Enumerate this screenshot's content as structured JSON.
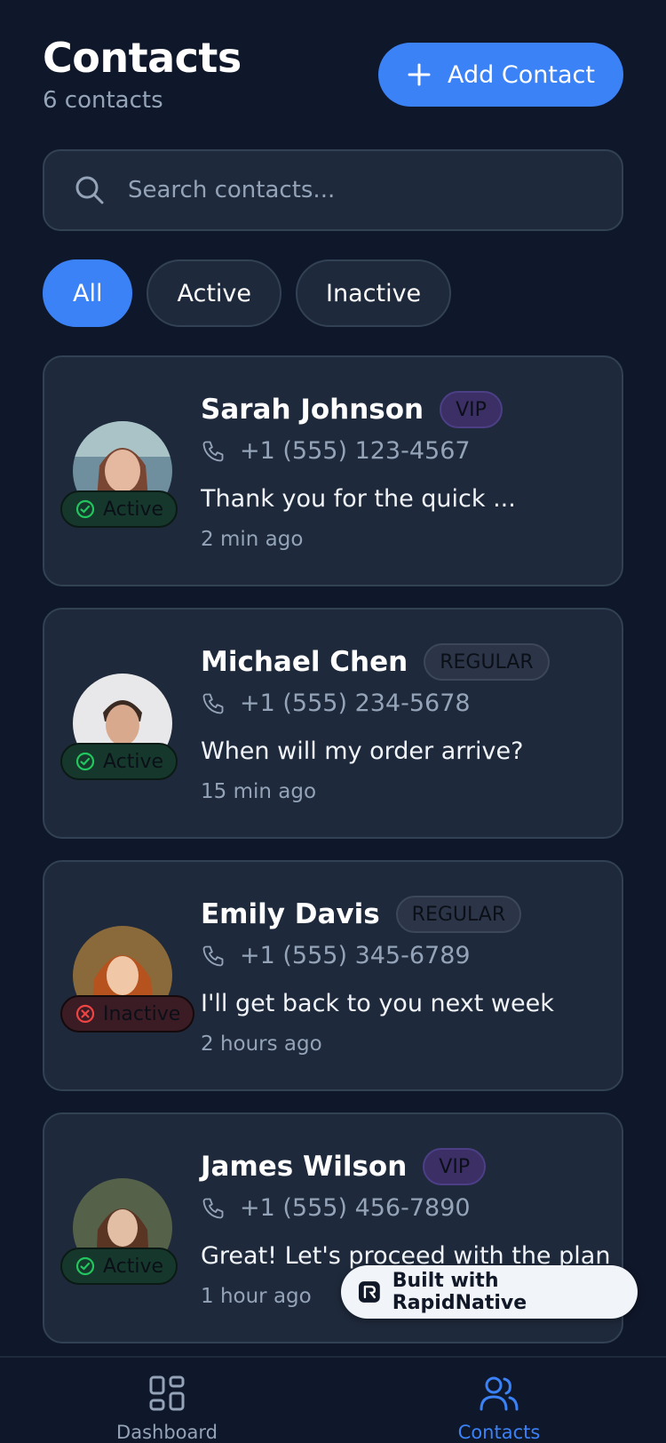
{
  "header": {
    "title": "Contacts",
    "count_text": "6 contacts",
    "add_label": "Add Contact"
  },
  "search": {
    "placeholder": "Search contacts..."
  },
  "filters": [
    "All",
    "Active",
    "Inactive"
  ],
  "contacts": [
    {
      "name": "Sarah Johnson",
      "tag": "VIP",
      "phone": "+1 (555) 123-4567",
      "message": "Thank you for the quick ...",
      "time": "2 min ago",
      "status": "Active"
    },
    {
      "name": "Michael Chen",
      "tag": "REGULAR",
      "phone": "+1 (555) 234-5678",
      "message": "When will my order arrive?",
      "time": "15 min ago",
      "status": "Active"
    },
    {
      "name": "Emily Davis",
      "tag": "REGULAR",
      "phone": "+1 (555) 345-6789",
      "message": "I'll get back to you next week",
      "time": "2 hours ago",
      "status": "Inactive"
    },
    {
      "name": "James Wilson",
      "tag": "VIP",
      "phone": "+1 (555) 456-7890",
      "message": "Great! Let's proceed with the plan",
      "time": "1 hour ago",
      "status": "Active"
    }
  ],
  "badge": {
    "text": "Built with RapidNative"
  },
  "tabs": [
    {
      "label": "Dashboard"
    },
    {
      "label": "Contacts"
    }
  ],
  "colors": {
    "accent": "#3b82f6",
    "background": "#0f172a",
    "card": "#1e293b",
    "muted": "#94a3b8"
  }
}
